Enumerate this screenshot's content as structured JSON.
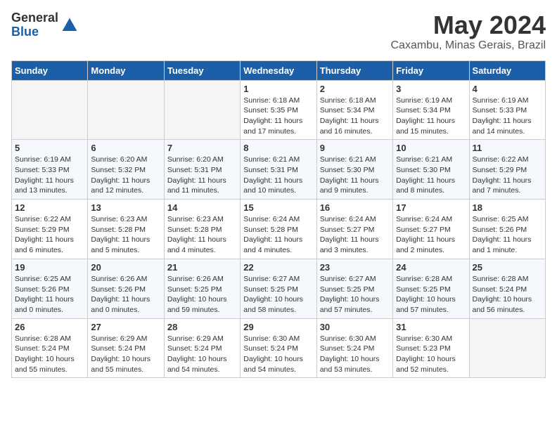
{
  "logo": {
    "general": "General",
    "blue": "Blue"
  },
  "title": "May 2024",
  "location": "Caxambu, Minas Gerais, Brazil",
  "weekdays": [
    "Sunday",
    "Monday",
    "Tuesday",
    "Wednesday",
    "Thursday",
    "Friday",
    "Saturday"
  ],
  "weeks": [
    [
      {
        "day": "",
        "info": ""
      },
      {
        "day": "",
        "info": ""
      },
      {
        "day": "",
        "info": ""
      },
      {
        "day": "1",
        "info": "Sunrise: 6:18 AM\nSunset: 5:35 PM\nDaylight: 11 hours\nand 17 minutes."
      },
      {
        "day": "2",
        "info": "Sunrise: 6:18 AM\nSunset: 5:34 PM\nDaylight: 11 hours\nand 16 minutes."
      },
      {
        "day": "3",
        "info": "Sunrise: 6:19 AM\nSunset: 5:34 PM\nDaylight: 11 hours\nand 15 minutes."
      },
      {
        "day": "4",
        "info": "Sunrise: 6:19 AM\nSunset: 5:33 PM\nDaylight: 11 hours\nand 14 minutes."
      }
    ],
    [
      {
        "day": "5",
        "info": "Sunrise: 6:19 AM\nSunset: 5:33 PM\nDaylight: 11 hours\nand 13 minutes."
      },
      {
        "day": "6",
        "info": "Sunrise: 6:20 AM\nSunset: 5:32 PM\nDaylight: 11 hours\nand 12 minutes."
      },
      {
        "day": "7",
        "info": "Sunrise: 6:20 AM\nSunset: 5:31 PM\nDaylight: 11 hours\nand 11 minutes."
      },
      {
        "day": "8",
        "info": "Sunrise: 6:21 AM\nSunset: 5:31 PM\nDaylight: 11 hours\nand 10 minutes."
      },
      {
        "day": "9",
        "info": "Sunrise: 6:21 AM\nSunset: 5:30 PM\nDaylight: 11 hours\nand 9 minutes."
      },
      {
        "day": "10",
        "info": "Sunrise: 6:21 AM\nSunset: 5:30 PM\nDaylight: 11 hours\nand 8 minutes."
      },
      {
        "day": "11",
        "info": "Sunrise: 6:22 AM\nSunset: 5:29 PM\nDaylight: 11 hours\nand 7 minutes."
      }
    ],
    [
      {
        "day": "12",
        "info": "Sunrise: 6:22 AM\nSunset: 5:29 PM\nDaylight: 11 hours\nand 6 minutes."
      },
      {
        "day": "13",
        "info": "Sunrise: 6:23 AM\nSunset: 5:28 PM\nDaylight: 11 hours\nand 5 minutes."
      },
      {
        "day": "14",
        "info": "Sunrise: 6:23 AM\nSunset: 5:28 PM\nDaylight: 11 hours\nand 4 minutes."
      },
      {
        "day": "15",
        "info": "Sunrise: 6:24 AM\nSunset: 5:28 PM\nDaylight: 11 hours\nand 4 minutes."
      },
      {
        "day": "16",
        "info": "Sunrise: 6:24 AM\nSunset: 5:27 PM\nDaylight: 11 hours\nand 3 minutes."
      },
      {
        "day": "17",
        "info": "Sunrise: 6:24 AM\nSunset: 5:27 PM\nDaylight: 11 hours\nand 2 minutes."
      },
      {
        "day": "18",
        "info": "Sunrise: 6:25 AM\nSunset: 5:26 PM\nDaylight: 11 hours\nand 1 minute."
      }
    ],
    [
      {
        "day": "19",
        "info": "Sunrise: 6:25 AM\nSunset: 5:26 PM\nDaylight: 11 hours\nand 0 minutes."
      },
      {
        "day": "20",
        "info": "Sunrise: 6:26 AM\nSunset: 5:26 PM\nDaylight: 11 hours\nand 0 minutes."
      },
      {
        "day": "21",
        "info": "Sunrise: 6:26 AM\nSunset: 5:25 PM\nDaylight: 10 hours\nand 59 minutes."
      },
      {
        "day": "22",
        "info": "Sunrise: 6:27 AM\nSunset: 5:25 PM\nDaylight: 10 hours\nand 58 minutes."
      },
      {
        "day": "23",
        "info": "Sunrise: 6:27 AM\nSunset: 5:25 PM\nDaylight: 10 hours\nand 57 minutes."
      },
      {
        "day": "24",
        "info": "Sunrise: 6:28 AM\nSunset: 5:25 PM\nDaylight: 10 hours\nand 57 minutes."
      },
      {
        "day": "25",
        "info": "Sunrise: 6:28 AM\nSunset: 5:24 PM\nDaylight: 10 hours\nand 56 minutes."
      }
    ],
    [
      {
        "day": "26",
        "info": "Sunrise: 6:28 AM\nSunset: 5:24 PM\nDaylight: 10 hours\nand 55 minutes."
      },
      {
        "day": "27",
        "info": "Sunrise: 6:29 AM\nSunset: 5:24 PM\nDaylight: 10 hours\nand 55 minutes."
      },
      {
        "day": "28",
        "info": "Sunrise: 6:29 AM\nSunset: 5:24 PM\nDaylight: 10 hours\nand 54 minutes."
      },
      {
        "day": "29",
        "info": "Sunrise: 6:30 AM\nSunset: 5:24 PM\nDaylight: 10 hours\nand 54 minutes."
      },
      {
        "day": "30",
        "info": "Sunrise: 6:30 AM\nSunset: 5:24 PM\nDaylight: 10 hours\nand 53 minutes."
      },
      {
        "day": "31",
        "info": "Sunrise: 6:30 AM\nSunset: 5:23 PM\nDaylight: 10 hours\nand 52 minutes."
      },
      {
        "day": "",
        "info": ""
      }
    ]
  ]
}
